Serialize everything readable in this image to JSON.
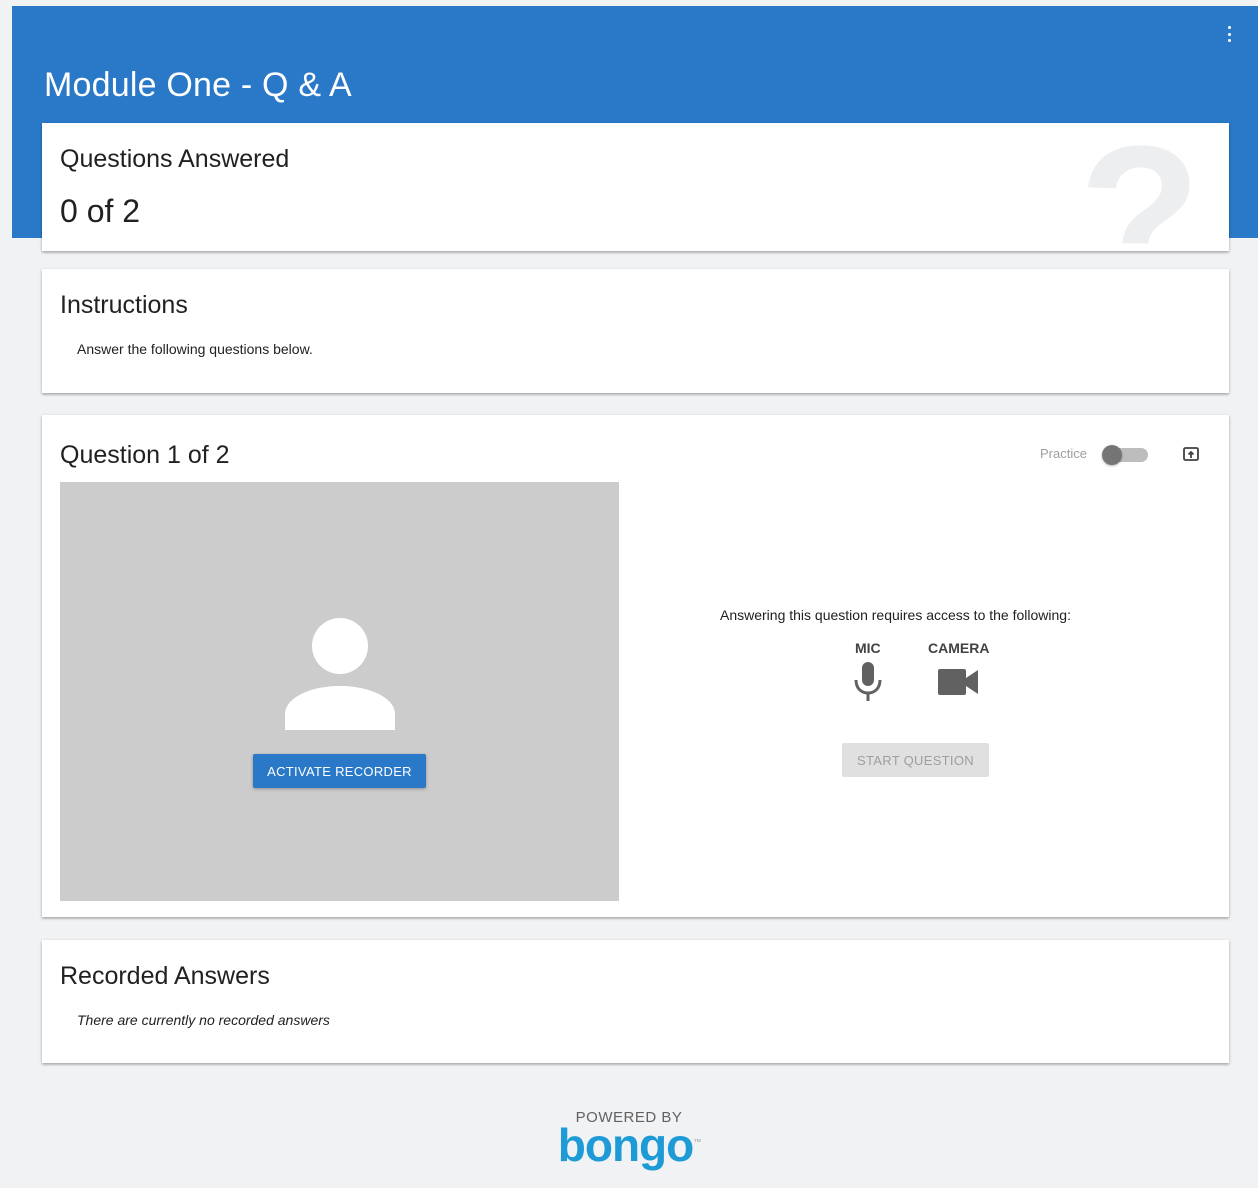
{
  "header": {
    "title": "Module One - Q & A"
  },
  "answered": {
    "title": "Questions Answered",
    "count": "0 of 2",
    "watermark": "?"
  },
  "instructions": {
    "title": "Instructions",
    "text": "Answer the following questions below."
  },
  "question": {
    "title": "Question 1 of 2",
    "practice_label": "Practice",
    "practice_enabled": false,
    "activate_button": "ACTIVATE RECORDER",
    "requires_text": "Answering this question requires access to the following:",
    "permissions": [
      {
        "label": "MIC",
        "icon": "mic-icon"
      },
      {
        "label": "CAMERA",
        "icon": "camera-icon"
      }
    ],
    "start_button": "START QUESTION"
  },
  "recorded": {
    "title": "Recorded Answers",
    "empty_text": "There are currently no recorded answers"
  },
  "footer": {
    "powered_by": "POWERED BY",
    "brand": "bongo"
  },
  "colors": {
    "accent": "#2979c8",
    "background": "#f1f2f4",
    "recorder_bg": "#cccccc",
    "brand": "#1e9ad6"
  }
}
